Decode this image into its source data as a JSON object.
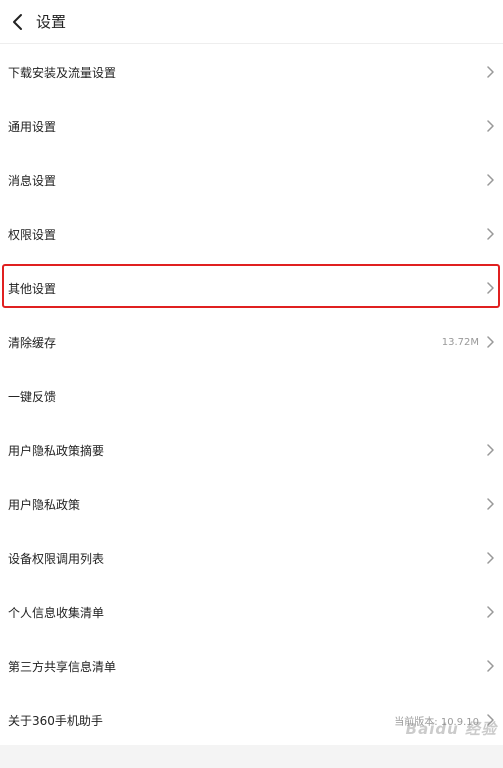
{
  "header": {
    "title": "设置",
    "back_icon": "chevron-left-icon"
  },
  "rows": [
    {
      "label": "下载安装及流量设置",
      "value": "",
      "chevron": true
    },
    {
      "label": "通用设置",
      "value": "",
      "chevron": true
    },
    {
      "label": "消息设置",
      "value": "",
      "chevron": true
    },
    {
      "label": "权限设置",
      "value": "",
      "chevron": true
    },
    {
      "label": "其他设置",
      "value": "",
      "chevron": true,
      "highlighted": true
    },
    {
      "label": "清除缓存",
      "value": "13.72M",
      "chevron": true
    },
    {
      "label": "一键反馈",
      "value": "",
      "chevron": false
    },
    {
      "label": "用户隐私政策摘要",
      "value": "",
      "chevron": true
    },
    {
      "label": "用户隐私政策",
      "value": "",
      "chevron": true
    },
    {
      "label": "设备权限调用列表",
      "value": "",
      "chevron": true
    },
    {
      "label": "个人信息收集清单",
      "value": "",
      "chevron": true
    },
    {
      "label": "第三方共享信息清单",
      "value": "",
      "chevron": true
    },
    {
      "label": "关于360手机助手",
      "value": "当前版本: 10.9.10",
      "chevron": true
    }
  ],
  "watermark": {
    "text": "Baidu 经验"
  },
  "colors": {
    "highlight_border": "#e02020",
    "chevron": "#999999",
    "value_text": "#999999"
  }
}
